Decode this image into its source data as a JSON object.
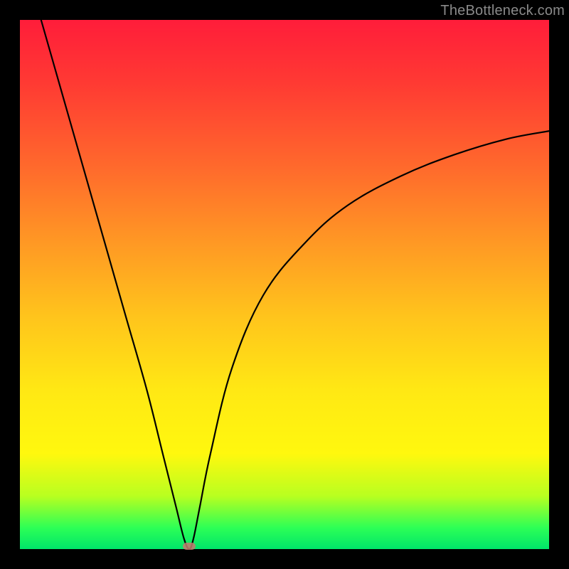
{
  "watermark": "TheBottleneck.com",
  "chart_data": {
    "type": "line",
    "title": "",
    "xlabel": "",
    "ylabel": "",
    "xlim": [
      0,
      100
    ],
    "ylim": [
      0,
      100
    ],
    "grid": false,
    "legend": false,
    "background_gradient": {
      "top": "#ff1d3a",
      "bottom": "#00e56a"
    },
    "series": [
      {
        "name": "bottleneck-curve",
        "x": [
          4,
          8,
          12,
          16,
          20,
          24,
          27,
          29.5,
          31,
          32,
          32.8,
          34,
          36,
          40,
          46,
          54,
          62,
          72,
          82,
          92,
          100
        ],
        "y": [
          100,
          86,
          72,
          58,
          44,
          30,
          18,
          8,
          2,
          0,
          2,
          8,
          18,
          34,
          48,
          58,
          65,
          70.5,
          74.5,
          77.5,
          79
        ]
      }
    ],
    "marker": {
      "name": "optimal-point",
      "x": 32,
      "y": 0.5,
      "color": "#c47a6f"
    }
  }
}
